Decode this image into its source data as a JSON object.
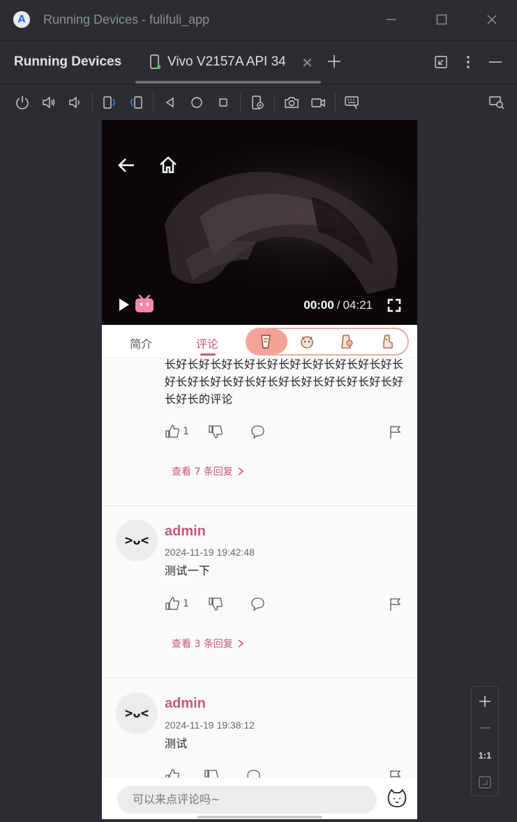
{
  "window": {
    "title": "Running Devices - fulifuli_app"
  },
  "panel": {
    "title": "Running Devices",
    "tab_label": "Vivo V2157A API 34"
  },
  "video": {
    "current_time": "00:00",
    "separator": "/",
    "total_time": "04:21"
  },
  "tabs": {
    "intro": "简介",
    "comments": "评论"
  },
  "comments": [
    {
      "text": "长好长好长好长好长好长好长好长好长好长好长好长好长好长好长好长好长好长好长好长好长好长好长的评论",
      "likes": "1",
      "replies": "查看 7 条回复"
    },
    {
      "avatar": ">ᴗ<",
      "username": "admin",
      "date": "2024-11-19 19:42:48",
      "text": "测试一下",
      "likes": "1",
      "replies": "查看 3 条回复"
    },
    {
      "avatar": ">ᴗ<",
      "username": "admin",
      "date": "2024-11-19 19:38:12",
      "text": "测试"
    }
  ],
  "comment_input": {
    "placeholder": "可以来点评论吗~"
  },
  "zoom": {
    "one_to_one": "1:1"
  },
  "colors": {
    "accent": "#c6577a",
    "ide_bg": "#2b2d30",
    "sticker_active": "#f4a497"
  }
}
